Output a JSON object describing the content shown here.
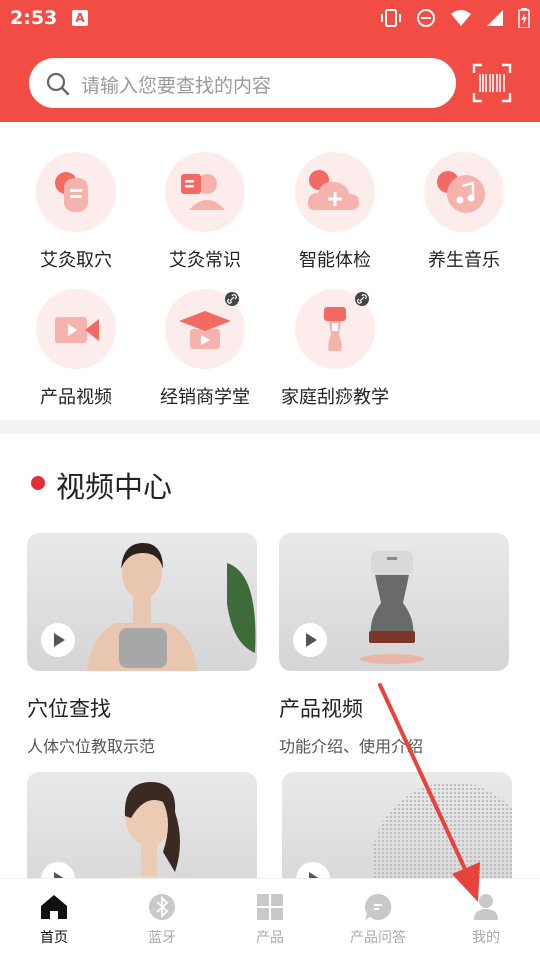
{
  "status": {
    "time": "2:53",
    "notification_icon": "A"
  },
  "search": {
    "placeholder": "请输入您要查找的内容"
  },
  "colors": {
    "brand_red": "#f24d44",
    "accent_red": "#e0313a",
    "icon_soft": "#fcecec"
  },
  "grid": [
    {
      "label": "艾灸取穴",
      "icon": "acupoint-icon",
      "link": false
    },
    {
      "label": "艾灸常识",
      "icon": "knowledge-icon",
      "link": false
    },
    {
      "label": "智能体检",
      "icon": "cloud-add-icon",
      "link": false
    },
    {
      "label": "养生音乐",
      "icon": "music-icon",
      "link": false
    },
    {
      "label": "产品视频",
      "icon": "video-camera-icon",
      "link": false
    },
    {
      "label": "经销商学堂",
      "icon": "graduation-cap-icon",
      "link": true
    },
    {
      "label": "家庭刮痧教学",
      "icon": "scraping-tool-icon",
      "link": true
    }
  ],
  "video_section": {
    "title": "视频中心",
    "cards": [
      {
        "title": "穴位查找",
        "subtitle": "人体穴位教取示范",
        "thumb": "woman-acupoints-thumbnail"
      },
      {
        "title": "产品视频",
        "subtitle": "功能介绍、使用介绍",
        "thumb": "device-thumbnail"
      },
      {
        "title": "",
        "subtitle": "",
        "thumb": "woman-portrait-thumbnail"
      },
      {
        "title": "",
        "subtitle": "",
        "thumb": "texture-thumbnail"
      }
    ]
  },
  "nav": [
    {
      "label": "首页",
      "icon": "home-icon",
      "active": true
    },
    {
      "label": "蓝牙",
      "icon": "bluetooth-icon",
      "active": false
    },
    {
      "label": "产品",
      "icon": "grid-icon",
      "active": false
    },
    {
      "label": "产品问答",
      "icon": "chat-icon",
      "active": false
    },
    {
      "label": "我的",
      "icon": "user-icon",
      "active": false
    }
  ]
}
